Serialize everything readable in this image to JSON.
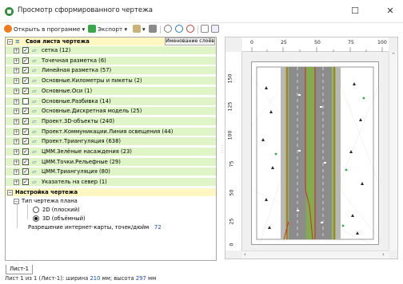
{
  "window": {
    "title": "Просмотр сформированного чертежа",
    "minimize_glyph": "☐",
    "close_glyph": "✕"
  },
  "toolbar": {
    "open_in_program": "Открыть в программе",
    "export": "Экспорт",
    "icons": [
      "open-in-program-icon",
      "export-icon",
      "paint-icon",
      "print-icon",
      "hand-icon",
      "zoom-in-icon",
      "zoom-out-icon",
      "page-icon",
      "page-settings-icon"
    ]
  },
  "tree": {
    "root_label": "Свои листа чертежа",
    "naming_button": "Именование слоёв",
    "layers": [
      {
        "label": "сетка (12)",
        "checked": true
      },
      {
        "label": "Точечная разметка (6)",
        "checked": true
      },
      {
        "label": "Линейная разметка (57)",
        "checked": true
      },
      {
        "label": "Основные.Километры и пикеты (2)",
        "checked": true
      },
      {
        "label": "Основные.Оси (1)",
        "checked": true
      },
      {
        "label": "Основные.Разбивка (14)",
        "checked": false
      },
      {
        "label": "Основные.Дискретная модель (25)",
        "checked": true
      },
      {
        "label": "Проект.3D-объекты (240)",
        "checked": true
      },
      {
        "label": "Проект.Коммуникации.Линия освещения (44)",
        "checked": true
      },
      {
        "label": "Проект.Триангуляция (638)",
        "checked": true
      },
      {
        "label": "ЦММ.Зелёные насаждения (23)",
        "checked": true
      },
      {
        "label": "ЦММ.Точки.Рельефные (29)",
        "checked": true
      },
      {
        "label": "ЦММ.Триангуляция (80)",
        "checked": true
      },
      {
        "label": "Указатель на север (1)",
        "checked": true
      }
    ],
    "settings_label": "Настройка чертежа",
    "plan_type_label": "Тип чертежа плана",
    "options": [
      {
        "label": "2D (плоский)",
        "selected": false
      },
      {
        "label": "3D (объёмный)",
        "selected": true
      }
    ],
    "resolution_label": "Разрешение интернет-карты, точек/дюйм",
    "resolution_value": "72"
  },
  "ruler": {
    "top": [
      "0",
      "25",
      "50",
      "75",
      "100"
    ],
    "left": [
      "150",
      "125",
      "100",
      "75",
      "50",
      "25",
      "0"
    ]
  },
  "tabs": {
    "sheet_tab": "Лист-1"
  },
  "status": {
    "prefix": "Лист 1 из 1 (Лист-1): ширина ",
    "width_value": "210",
    "mid": " мм; высота ",
    "height_value": "297",
    "suffix": " мм"
  },
  "colors": {
    "road_gray": "#8c8c8c",
    "median_green": "#7fae4a",
    "red_line": "#d22a2a",
    "grass_green": "#8cc152",
    "panel_green": "#dff5c7",
    "header_yellow": "#fff7c2"
  }
}
